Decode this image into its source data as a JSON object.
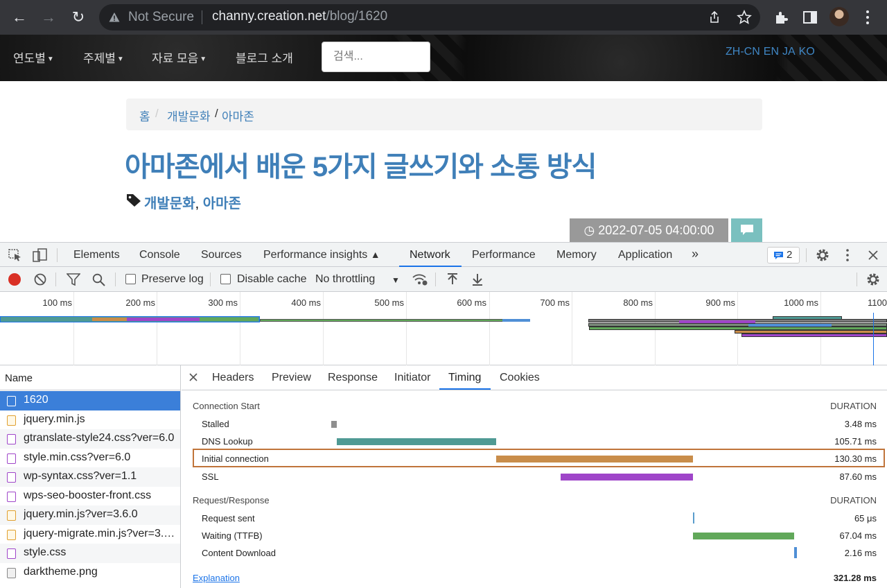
{
  "browser": {
    "not_secure": "Not Secure",
    "url_host": "channy.creation.net",
    "url_path": "/blog/1620"
  },
  "site": {
    "menu": [
      {
        "label": "연도별",
        "caret": true
      },
      {
        "label": "주제별",
        "caret": true
      },
      {
        "label": "자료 모음",
        "caret": true
      },
      {
        "label": "블로그 소개",
        "caret": false
      }
    ],
    "search_placeholder": "검색...",
    "languages": [
      "ZH-CN",
      "EN",
      "JA",
      "KO"
    ],
    "breadcrumb": {
      "home": "홈",
      "sep1": "/",
      "category": "개발문화",
      "sep2": "/",
      "current": "아마존"
    },
    "post_title": "아마존에서 배운 5가지 글쓰기와 소통 방식",
    "tags": [
      "개발문화",
      "아마존"
    ],
    "tag_sep": ",",
    "date": "2022-07-05 04:00:00"
  },
  "devtools": {
    "tabs": [
      "Elements",
      "Console",
      "Sources",
      "Performance insights",
      "Network",
      "Performance",
      "Memory",
      "Application"
    ],
    "active_tab": "Network",
    "issues_count": "2",
    "preserve_log": "Preserve log",
    "disable_cache": "Disable cache",
    "throttling": "No throttling",
    "ticks": [
      "100 ms",
      "200 ms",
      "300 ms",
      "400 ms",
      "500 ms",
      "600 ms",
      "700 ms",
      "800 ms",
      "900 ms",
      "1000 ms",
      "1100"
    ],
    "name_header": "Name",
    "requests": [
      {
        "name": "1620",
        "type": "doc",
        "selected": true
      },
      {
        "name": "jquery.min.js",
        "type": "js"
      },
      {
        "name": "gtranslate-style24.css?ver=6.0",
        "type": "css"
      },
      {
        "name": "style.min.css?ver=6.0",
        "type": "css"
      },
      {
        "name": "wp-syntax.css?ver=1.1",
        "type": "css"
      },
      {
        "name": "wps-seo-booster-front.css",
        "type": "css"
      },
      {
        "name": "jquery.min.js?ver=3.6.0",
        "type": "js"
      },
      {
        "name": "jquery-migrate.min.js?ver=3.…",
        "type": "js"
      },
      {
        "name": "style.css",
        "type": "css"
      },
      {
        "name": "darktheme.png",
        "type": "img"
      }
    ],
    "detail_tabs": [
      "Headers",
      "Preview",
      "Response",
      "Initiator",
      "Timing",
      "Cookies"
    ],
    "active_detail_tab": "Timing",
    "timing": {
      "connection_start": "Connection Start",
      "request_response": "Request/Response",
      "duration": "DURATION",
      "explanation": "Explanation",
      "total": "321.28 ms",
      "rows": [
        {
          "label": "Stalled",
          "duration": "3.48 ms",
          "start_ms": 0,
          "length_ms": 3.48,
          "color": "#8f8f8f"
        },
        {
          "label": "DNS Lookup",
          "duration": "105.71 ms",
          "start_ms": 3.48,
          "length_ms": 105.71,
          "color": "#4f9a94"
        },
        {
          "label": "Initial connection",
          "duration": "130.30 ms",
          "start_ms": 109.19,
          "length_ms": 130.3,
          "color": "#c98d4a",
          "highlighted": true
        },
        {
          "label": "SSL",
          "duration": "87.60 ms",
          "start_ms": 151.89,
          "length_ms": 87.6,
          "color": "#9f45c9"
        },
        {
          "label": "Request sent",
          "duration": "65 μs",
          "start_ms": 239.49,
          "length_ms": 0.065,
          "color": "#5a9ccc"
        },
        {
          "label": "Waiting (TTFB)",
          "duration": "67.04 ms",
          "start_ms": 239.55,
          "length_ms": 67.04,
          "color": "#61a85a"
        },
        {
          "label": "Content Download",
          "duration": "2.16 ms",
          "start_ms": 306.59,
          "length_ms": 2.16,
          "color": "#4f8fd6"
        }
      ]
    }
  }
}
